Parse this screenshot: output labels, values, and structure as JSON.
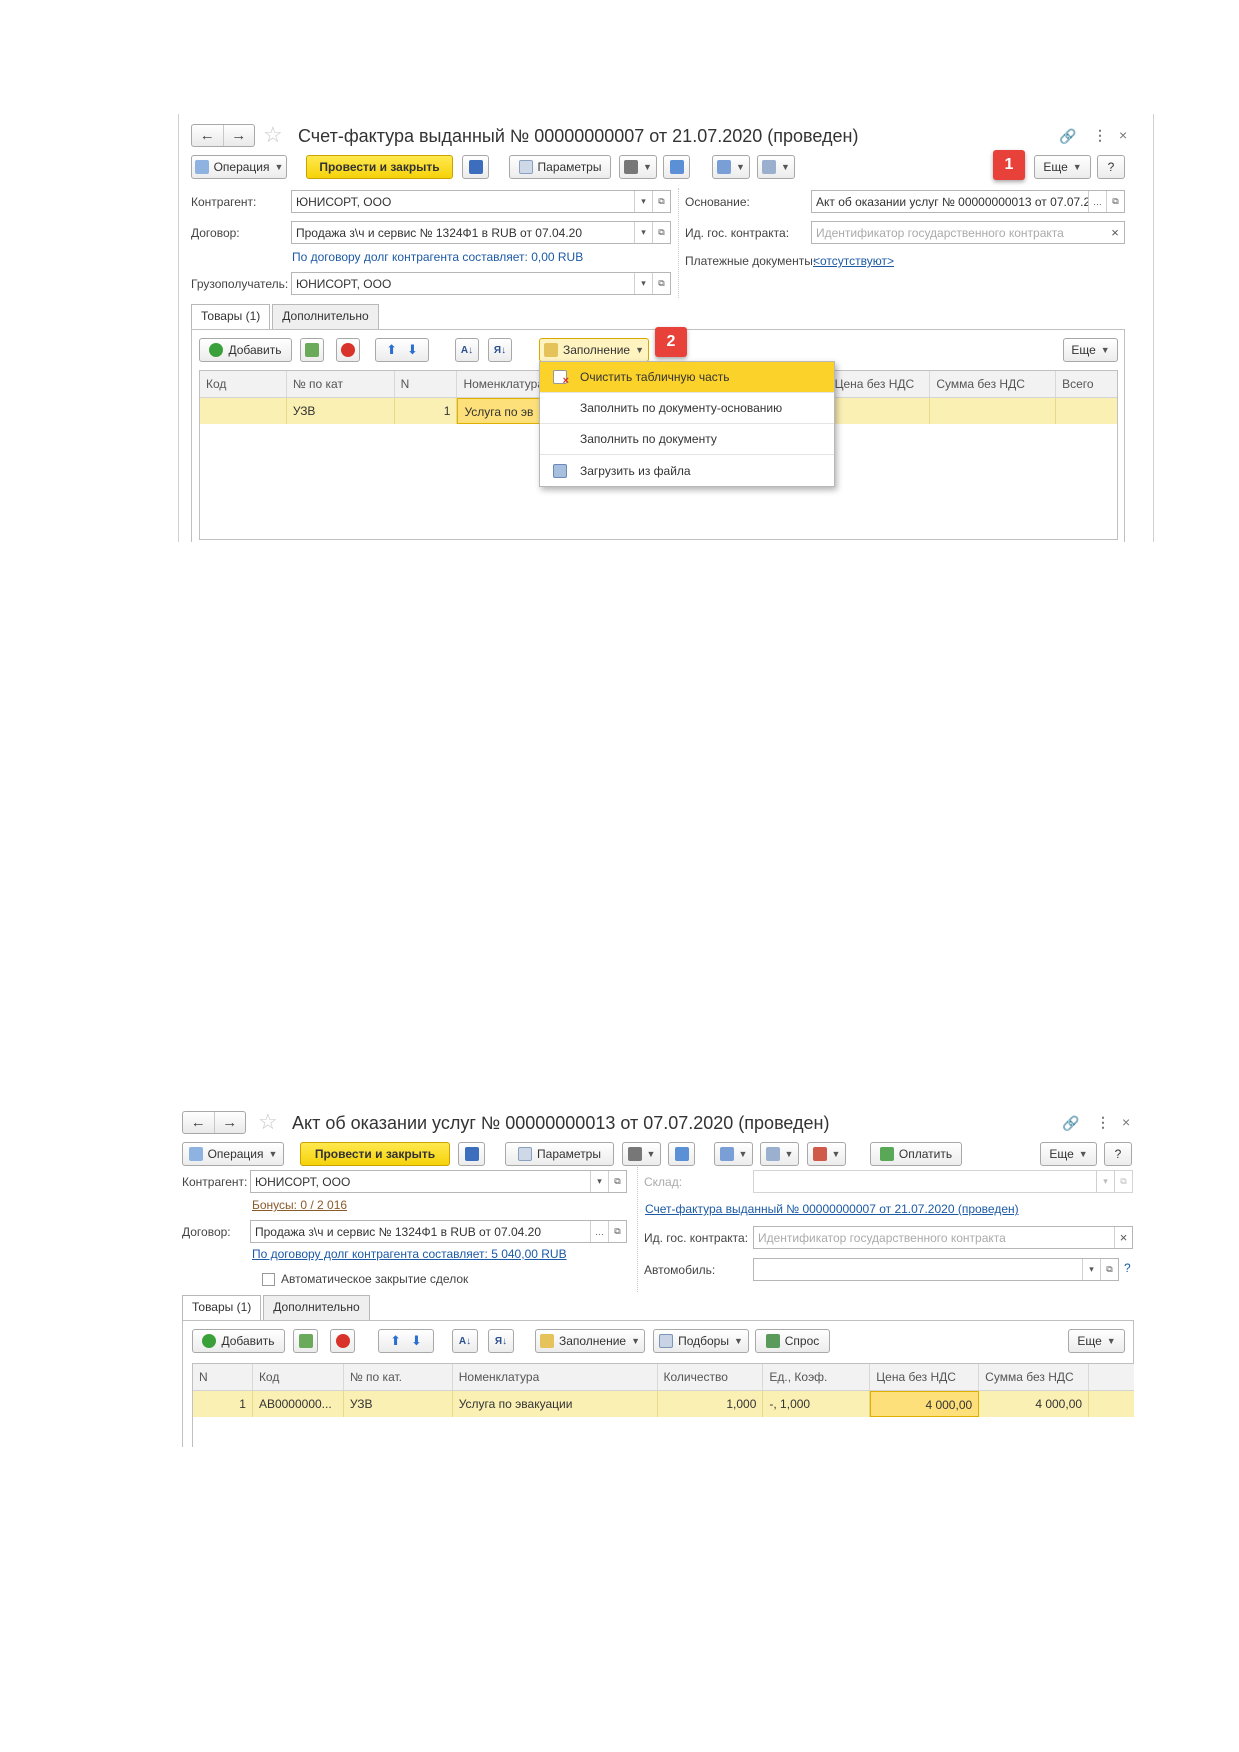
{
  "window1": {
    "title": "Счет-фактура выданный № 00000000007 от 21.07.2020 (проведен)",
    "toolbar": {
      "operation": "Операция",
      "post_close": "Провести и закрыть",
      "params": "Параметры",
      "more": "Еще",
      "help": "?"
    },
    "badge1": "1",
    "badge2": "2",
    "fields": {
      "counterparty_label": "Контрагент:",
      "counterparty_value": "ЮНИСОРТ, ООО",
      "contract_label": "Договор:",
      "contract_value": "Продажа з\\ч и сервис № 1324Ф1 в RUB от 07.04.20",
      "debt_text": "По договору долг контрагента составляет: 0,00 RUB",
      "consignee_label": "Грузополучатель:",
      "consignee_value": "ЮНИСОРТ, ООО",
      "basis_label": "Основание:",
      "basis_value": "Акт об оказании услуг № 00000000013 от 07.07.2",
      "gov_label": "Ид. гос. контракта:",
      "gov_placeholder": "Идентификатор государственного контракта",
      "pay_docs_label": "Платежные документы:",
      "pay_docs_link": "<отсутствуют>"
    },
    "tabs": [
      "Товары (1)",
      "Дополнительно"
    ],
    "table_toolbar": {
      "add": "Добавить",
      "fill": "Заполнение",
      "more": "Еще"
    },
    "columns": [
      "Код",
      "№ по кат",
      "N",
      "Номенклатура",
      "Цена без НДС",
      "Сумма без НДС",
      "Всего"
    ],
    "row": {
      "code": "",
      "cat": "УЗВ",
      "n": "1",
      "nomen": "Услуга по эв"
    },
    "menu": [
      "Очистить табличную часть",
      "Заполнить по документу-основанию",
      "Заполнить по документу",
      "Загрузить из файла"
    ]
  },
  "window2": {
    "title": "Акт об оказании услуг № 00000000013 от 07.07.2020 (проведен)",
    "toolbar": {
      "operation": "Операция",
      "post_close": "Провести и закрыть",
      "params": "Параметры",
      "pay": "Оплатить",
      "more": "Еще",
      "help": "?"
    },
    "fields": {
      "counterparty_label": "Контрагент:",
      "counterparty_value": "ЮНИСОРТ, ООО",
      "bonus_link": "Бонусы: 0 / 2 016",
      "contract_label": "Договор:",
      "contract_value": "Продажа з\\ч и сервис № 1324Ф1 в RUB от 07.04.20",
      "debt_link": "По договору долг контрагента составляет: 5 040,00 RUB",
      "auto_close_label": "Автоматическое закрытие сделок",
      "warehouse_label": "Склад:",
      "invoice_link": "Счет-фактура выданный № 00000000007 от 21.07.2020 (проведен)",
      "gov_label": "Ид. гос. контракта:",
      "gov_placeholder": "Идентификатор государственного контракта",
      "car_label": "Автомобиль:",
      "help_q": "?"
    },
    "tabs": [
      "Товары (1)",
      "Дополнительно"
    ],
    "table_toolbar": {
      "add": "Добавить",
      "fill": "Заполнение",
      "selection": "Подборы",
      "demand": "Спрос",
      "more": "Еще"
    },
    "columns": [
      "N",
      "Код",
      "№ по кат.",
      "Номенклатура",
      "Количество",
      "Ед., Коэф.",
      "Цена без НДС",
      "Сумма без НДС"
    ],
    "row": {
      "n": "1",
      "code": "АВ0000000...",
      "cat": "УЗВ",
      "nomen": "Услуга по эвакуации",
      "qty": "1,000",
      "unit": "-, 1,000",
      "price": "4 000,00",
      "sum": "4 000,00"
    }
  },
  "colors": {
    "accent_yellow": "#f6d20a",
    "badge_red": "#e8413a",
    "link_blue": "#1c5aa6",
    "row_highlight": "#fbf0b4"
  }
}
